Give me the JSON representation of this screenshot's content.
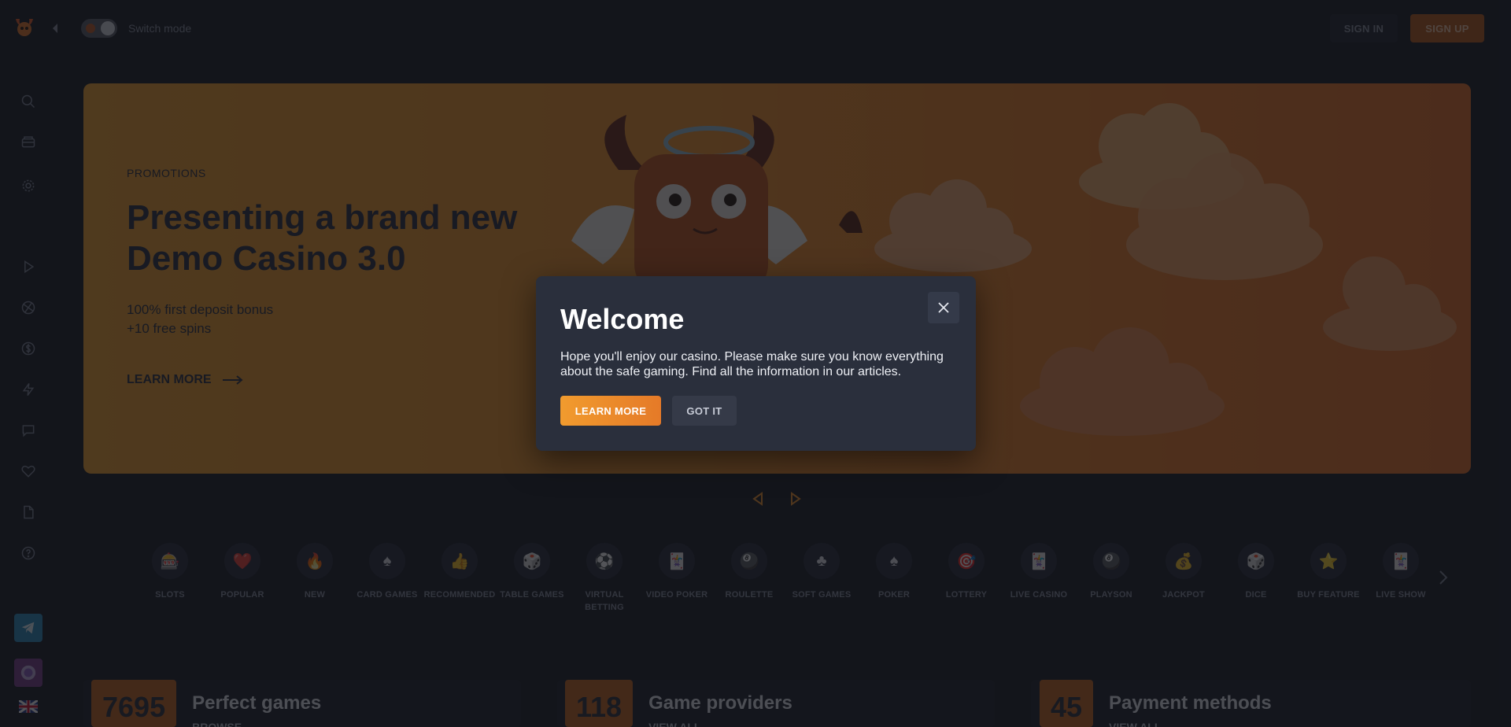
{
  "topbar": {
    "switch_label": "Switch mode",
    "signin_label": "SIGN IN",
    "signup_label": "SIGN UP"
  },
  "sidebar": {
    "icons": [
      "search-icon",
      "casino-chest-icon",
      "gear-icon",
      "play-icon",
      "sports-ball-icon",
      "dollar-icon",
      "lightning-icon",
      "chat-icon",
      "heart-icon",
      "document-icon",
      "help-icon"
    ],
    "bottom": [
      "telegram-icon",
      "profile-avatar-icon",
      "uk-flag-icon"
    ]
  },
  "banner": {
    "label": "PROMOTIONS",
    "title": "Presenting a brand new Demo Casino 3.0",
    "sub_line1": "100% first deposit bonus",
    "sub_line2": "+10 free spins",
    "link": "LEARN MORE"
  },
  "categories": [
    {
      "label": "SLOTS",
      "icon": "🎰"
    },
    {
      "label": "POPULAR",
      "icon": "❤️"
    },
    {
      "label": "NEW",
      "icon": "🔥"
    },
    {
      "label": "CARD GAMES",
      "icon": "♠"
    },
    {
      "label": "RECOMMENDED",
      "icon": "👍"
    },
    {
      "label": "TABLE GAMES",
      "icon": "🎲"
    },
    {
      "label": "VIRTUAL BETTING",
      "icon": "⚽"
    },
    {
      "label": "VIDEO POKER",
      "icon": "🃏"
    },
    {
      "label": "ROULETTE",
      "icon": "🎱"
    },
    {
      "label": "SOFT GAMES",
      "icon": "♣"
    },
    {
      "label": "POKER",
      "icon": "♠"
    },
    {
      "label": "LOTTERY",
      "icon": "🎯"
    },
    {
      "label": "LIVE CASINO",
      "icon": "🃏"
    },
    {
      "label": "PLAYSON",
      "icon": "🎱"
    },
    {
      "label": "JACKPOT",
      "icon": "💰"
    },
    {
      "label": "DICE",
      "icon": "🎲"
    },
    {
      "label": "BUY FEATURE",
      "icon": "⭐"
    },
    {
      "label": "LIVE SHOW",
      "icon": "🃏"
    }
  ],
  "stats": [
    {
      "number": "7695",
      "title": "Perfect games",
      "link": "BROWSE"
    },
    {
      "number": "118",
      "title": "Game providers",
      "link": "VIEW ALL"
    },
    {
      "number": "45",
      "title": "Payment methods",
      "link": "VIEW ALL"
    }
  ],
  "modal": {
    "title": "Welcome",
    "text": "Hope you'll enjoy our casino. Please make sure you know everything about the safe gaming. Find all the information in our articles.",
    "learn_label": "LEARN MORE",
    "got_label": "GOT IT"
  },
  "colors": {
    "accent": "#f0922b",
    "background": "#1b1e27",
    "modal_bg": "#2a2f3c"
  }
}
